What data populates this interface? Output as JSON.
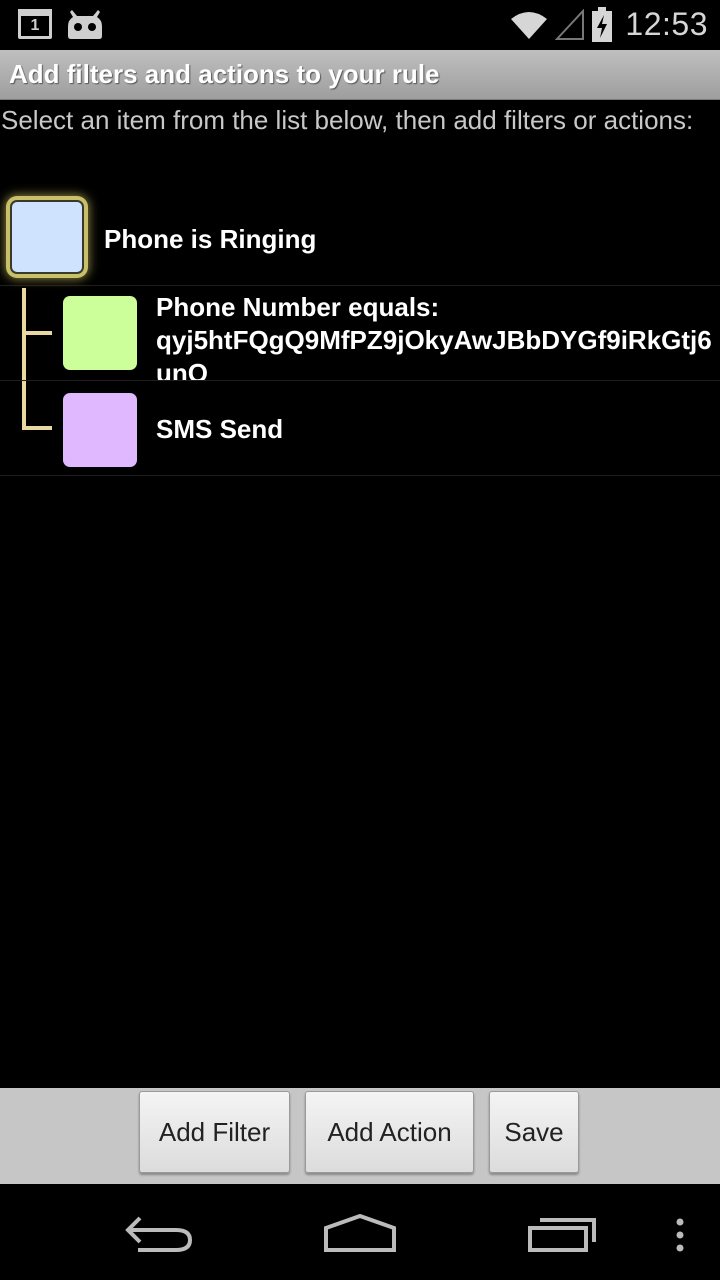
{
  "status_bar": {
    "notification_calendar_day": "1",
    "notification_icons": [
      "calendar-icon",
      "cyanogen-bot-icon"
    ],
    "system_icons": [
      "wifi-icon",
      "cell-signal-icon",
      "battery-charging-icon"
    ],
    "time": "12:53"
  },
  "title_bar": {
    "title": "Add filters and actions to your rule"
  },
  "instructions": "Select an item from the list below, then add filters or actions:",
  "tree": {
    "items": [
      {
        "label": "Phone is Ringing",
        "color": "#cfe3ff",
        "selected": true,
        "level": 0
      },
      {
        "label_line1": "Phone Number equals:",
        "label_line2": "qyj5htFQgQ9MfPZ9jOkyAwJBbDYGf9iRkGtj6",
        "label_line3": "unO",
        "color": "#ccff99",
        "level": 1
      },
      {
        "label": "SMS Send",
        "color": "#e0b8ff",
        "level": 1
      }
    ]
  },
  "buttons": {
    "add_filter": "Add Filter",
    "add_action": "Add Action",
    "save": "Save"
  },
  "nav_bar": {
    "icons": [
      "back-icon",
      "home-icon",
      "recent-apps-icon",
      "overflow-menu-icon"
    ]
  },
  "colors": {
    "title_bar": "#aaaaaa",
    "connector": "#e8d9a0",
    "button_bar": "#c6c6c6"
  }
}
